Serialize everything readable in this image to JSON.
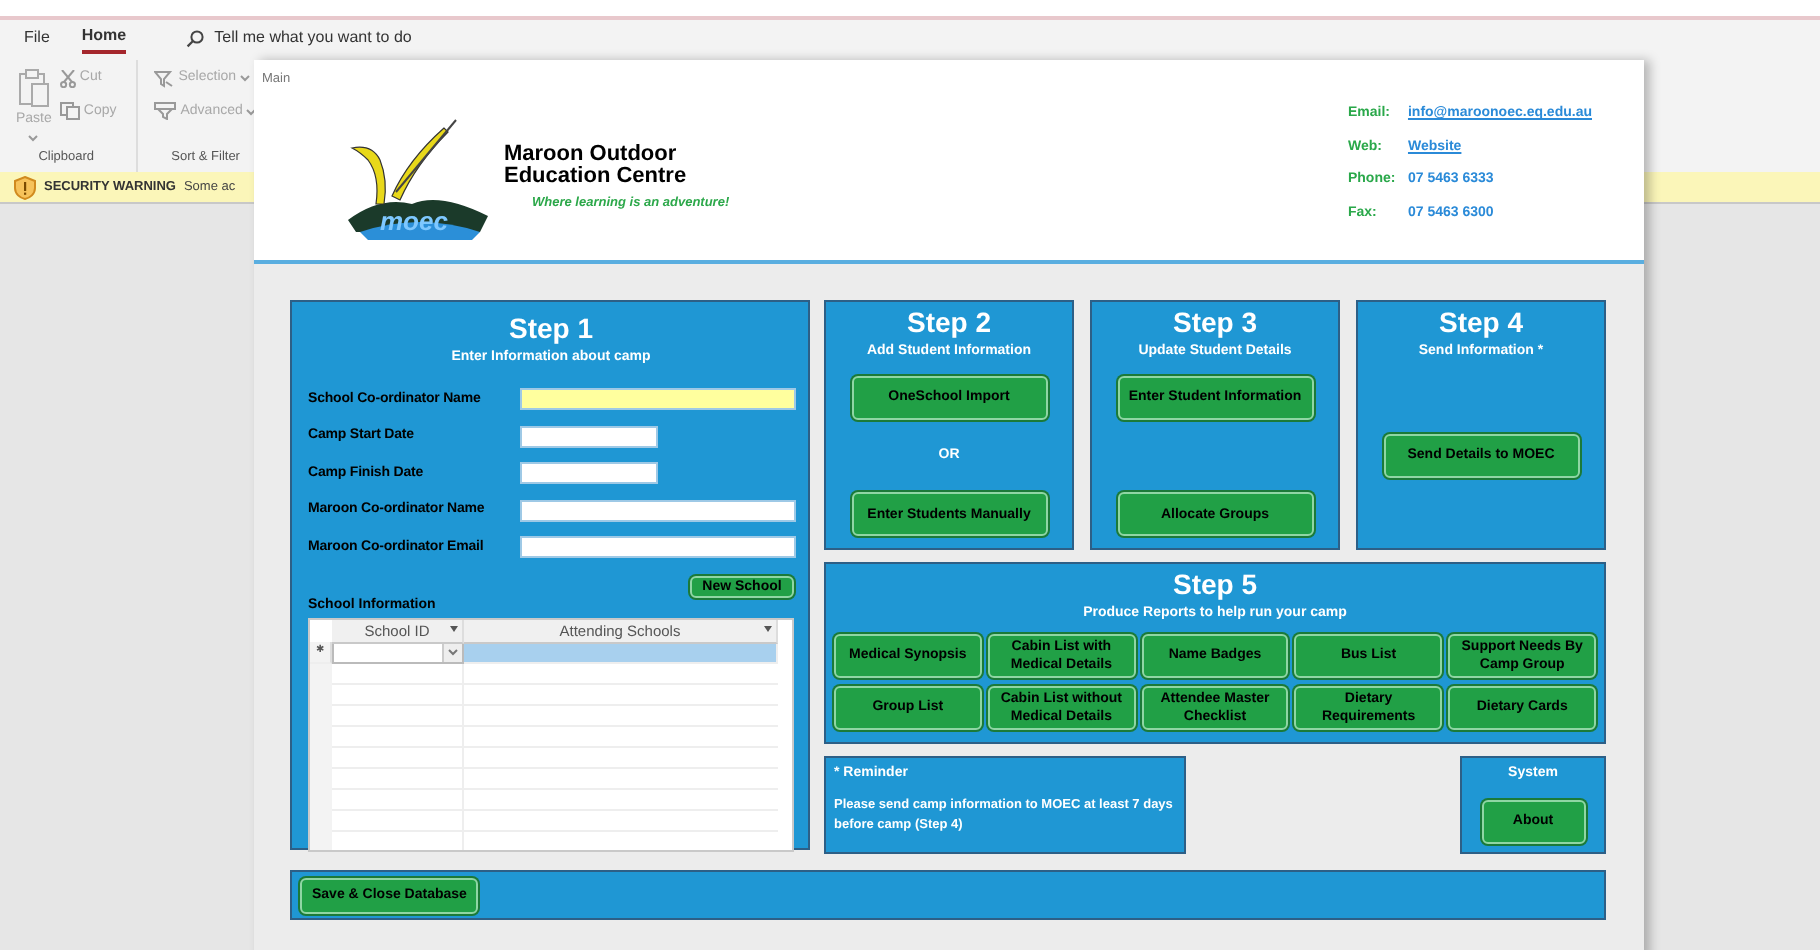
{
  "app": {
    "tabs": [
      {
        "label": "File",
        "selected": false
      },
      {
        "label": "Home",
        "selected": true
      }
    ],
    "search": {
      "placeholder": "Tell me what you want to do"
    },
    "ribbon_groups": [
      {
        "label": "Clipboard",
        "commands": [
          {
            "label": "Paste",
            "kind": "paste",
            "disabled": true
          },
          {
            "label": "Cut",
            "kind": "cut",
            "disabled": true
          },
          {
            "label": "Copy",
            "kind": "copy",
            "disabled": true
          }
        ]
      },
      {
        "label": "Sort & Filter",
        "commands": [
          {
            "label": "Selection",
            "kind": "selection",
            "disabled": true
          },
          {
            "label": "Advanced",
            "kind": "advanced",
            "disabled": true
          }
        ]
      }
    ],
    "security_warning": {
      "title": "SECURITY WARNING",
      "message": "Some ac"
    }
  },
  "form": {
    "title": "Main",
    "header": {
      "logo_mark": "moec",
      "org_name": [
        "Maroon Outdoor",
        "Education Centre"
      ],
      "tagline": "Where learning is an adventure!",
      "contacts": [
        {
          "label": "Email:",
          "value": "info@maroonoec.eq.edu.au",
          "kind": "link"
        },
        {
          "label": "Web:",
          "value": "Website",
          "kind": "link"
        },
        {
          "label": "Phone:",
          "value": "07 5463 6333",
          "kind": "text"
        },
        {
          "label": "Fax:",
          "value": "07 5463 6300",
          "kind": "text"
        }
      ]
    },
    "step1": {
      "title": "Step 1",
      "subtitle": "Enter Information about camp",
      "fields": [
        {
          "label": "School Co-ordinator Name",
          "kind": "text",
          "focused": true
        },
        {
          "label": "Camp Start Date",
          "kind": "date",
          "focused": false
        },
        {
          "label": "Camp Finish Date",
          "kind": "date",
          "focused": false
        },
        {
          "label": "Maroon Co-ordinator Name",
          "kind": "text",
          "focused": false
        },
        {
          "label": "Maroon Co-ordinator Email",
          "kind": "text",
          "focused": false
        }
      ],
      "new_school_button": "New School",
      "subform": {
        "title": "School Information",
        "columns": [
          "School ID",
          "Attending Schools"
        ],
        "new_row_marker": "✱"
      }
    },
    "steps": [
      {
        "title": "Step 2",
        "subtitle": "Add Student Information",
        "items": [
          {
            "kind": "button",
            "label": "OneSchool Import"
          },
          {
            "kind": "text",
            "label": "OR"
          },
          {
            "kind": "button",
            "label": "Enter Students Manually"
          }
        ]
      },
      {
        "title": "Step 3",
        "subtitle": "Update Student Details",
        "items": [
          {
            "kind": "button",
            "label": "Enter Student Information"
          },
          {
            "kind": "button",
            "label": "Allocate Groups"
          }
        ]
      },
      {
        "title": "Step 4",
        "subtitle": "Send Information *",
        "items": [
          {
            "kind": "button",
            "label": "Send Details to MOEC"
          }
        ]
      }
    ],
    "step5": {
      "title": "Step 5",
      "subtitle": "Produce Reports to help run your camp",
      "buttons": [
        "Medical Synopsis",
        "Cabin List with Medical Details",
        "Name Badges",
        "Bus List",
        "Support Needs By Camp Group",
        "Group List",
        "Cabin List without Medical Details",
        "Attendee Master Checklist",
        "Dietary Requirements",
        "Dietary Cards"
      ]
    },
    "reminder": {
      "title": "* Reminder",
      "text": "Please send camp information to MOEC at least 7 days before camp (Step 4)"
    },
    "system": {
      "title": "System",
      "button": "About"
    },
    "save_button": "Save & Close Database"
  }
}
